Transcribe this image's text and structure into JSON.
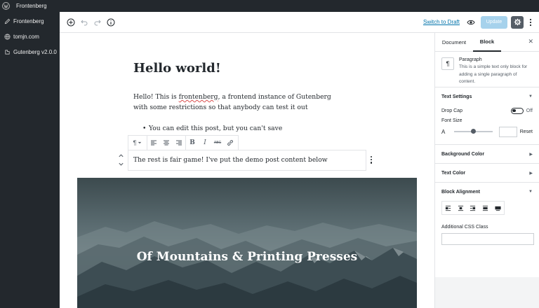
{
  "adminbar": {
    "site_name": "Frontenberg"
  },
  "adminmenu": {
    "items": [
      {
        "label": "Frontenberg",
        "icon": "pencil-icon"
      },
      {
        "label": "tomjn.com",
        "icon": "globe-icon"
      },
      {
        "label": "Gutenberg v2.0.0",
        "icon": "plugin-icon"
      }
    ]
  },
  "header": {
    "switch_to_draft": "Switch to Draft",
    "update_label": "Update"
  },
  "post": {
    "title": "Hello world!",
    "paragraph_before": "Hello! This is ",
    "paragraph_link": "frontenberg",
    "paragraph_after": ", a frontend instance of Gutenberg with some restrictions so that anybody can test it out",
    "list_item": "You can edit this post, but you can't save",
    "active_block_text": "The rest is fair game! I've put the demo post content below",
    "cover_title": "Of Mountains & Printing Presses"
  },
  "block_toolbar": {
    "paragraph_glyph": "¶",
    "strikethrough_label": "ABC"
  },
  "sidebar": {
    "tabs": {
      "document": "Document",
      "block": "Block"
    },
    "close_glyph": "✕",
    "block_card": {
      "icon_glyph": "¶",
      "name": "Paragraph",
      "description": "This is a simple text only block for adding a single paragraph of content."
    },
    "panels": {
      "text_settings": "Text Settings",
      "drop_cap": "Drop Cap",
      "drop_cap_state": "Off",
      "font_size": "Font Size",
      "font_size_a": "A",
      "reset": "Reset",
      "background_color": "Background Color",
      "text_color": "Text Color",
      "block_alignment": "Block Alignment",
      "additional_css": "Additional CSS Class"
    }
  },
  "colors": {
    "accent": "#0073aa",
    "admin_dark": "#23282d",
    "update_disabled": "#a6d2ec"
  }
}
